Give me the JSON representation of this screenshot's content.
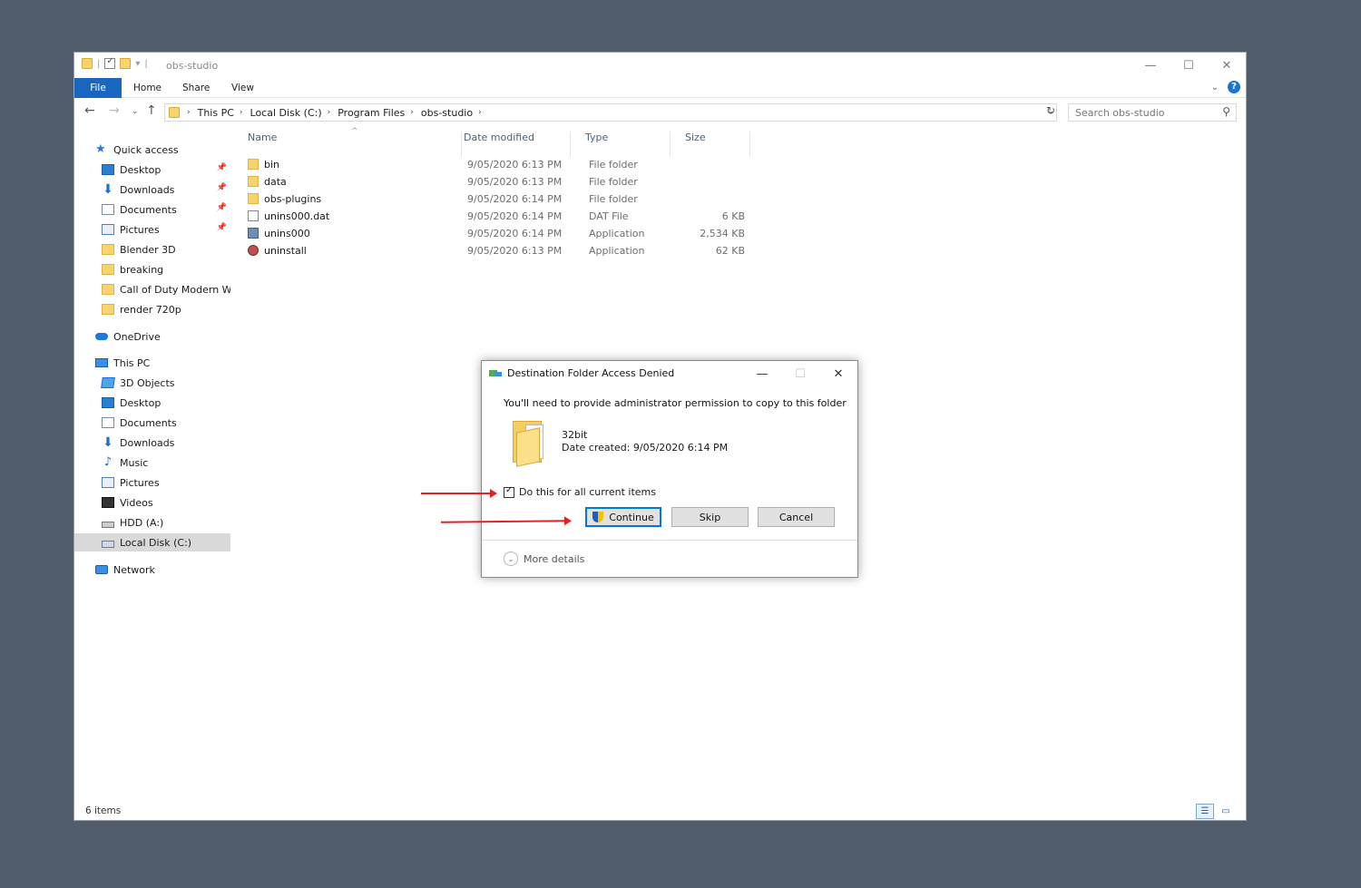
{
  "window": {
    "title": "obs-studio",
    "ribbon_tabs": [
      "File",
      "Home",
      "Share",
      "View"
    ]
  },
  "address": {
    "crumbs": [
      "This PC",
      "Local Disk (C:)",
      "Program Files",
      "obs-studio"
    ],
    "search_placeholder": "Search obs-studio"
  },
  "sidebar": {
    "quick_access": "Quick access",
    "quick_items": [
      "Desktop",
      "Downloads",
      "Documents",
      "Pictures",
      "Blender 3D",
      "breaking",
      "Call of Duty  Modern Warfare",
      "render 720p"
    ],
    "onedrive": "OneDrive",
    "this_pc": "This PC",
    "pc_items": [
      "3D Objects",
      "Desktop",
      "Documents",
      "Downloads",
      "Music",
      "Pictures",
      "Videos",
      "HDD (A:)",
      "Local Disk (C:)"
    ],
    "network": "Network"
  },
  "columns": [
    "Name",
    "Date modified",
    "Type",
    "Size"
  ],
  "files": [
    {
      "name": "bin",
      "date": "9/05/2020 6:13 PM",
      "type": "File folder",
      "size": "",
      "icon": "folder-icon"
    },
    {
      "name": "data",
      "date": "9/05/2020 6:13 PM",
      "type": "File folder",
      "size": "",
      "icon": "folder-icon"
    },
    {
      "name": "obs-plugins",
      "date": "9/05/2020 6:14 PM",
      "type": "File folder",
      "size": "",
      "icon": "folder-icon"
    },
    {
      "name": "unins000.dat",
      "date": "9/05/2020 6:14 PM",
      "type": "DAT File",
      "size": "6 KB",
      "icon": "file-icon"
    },
    {
      "name": "unins000",
      "date": "9/05/2020 6:14 PM",
      "type": "Application",
      "size": "2,534 KB",
      "icon": "app-icon"
    },
    {
      "name": "uninstall",
      "date": "9/05/2020 6:13 PM",
      "type": "Application",
      "size": "62 KB",
      "icon": "uninstall-icon"
    }
  ],
  "status": {
    "count": "6 items"
  },
  "dialog": {
    "title": "Destination Folder Access Denied",
    "message": "You'll need to provide administrator permission to copy to this folder",
    "folder_name": "32bit",
    "date_created": "Date created: 9/05/2020 6:14 PM",
    "checkbox_label": "Do this for all current items",
    "checkbox_checked": true,
    "continue_label": "Continue",
    "skip_label": "Skip",
    "cancel_label": "Cancel",
    "more_details": "More details"
  },
  "colors": {
    "accent": "#1967c0",
    "annotation": "#e32222",
    "desktop_bg": "#525d6b"
  }
}
